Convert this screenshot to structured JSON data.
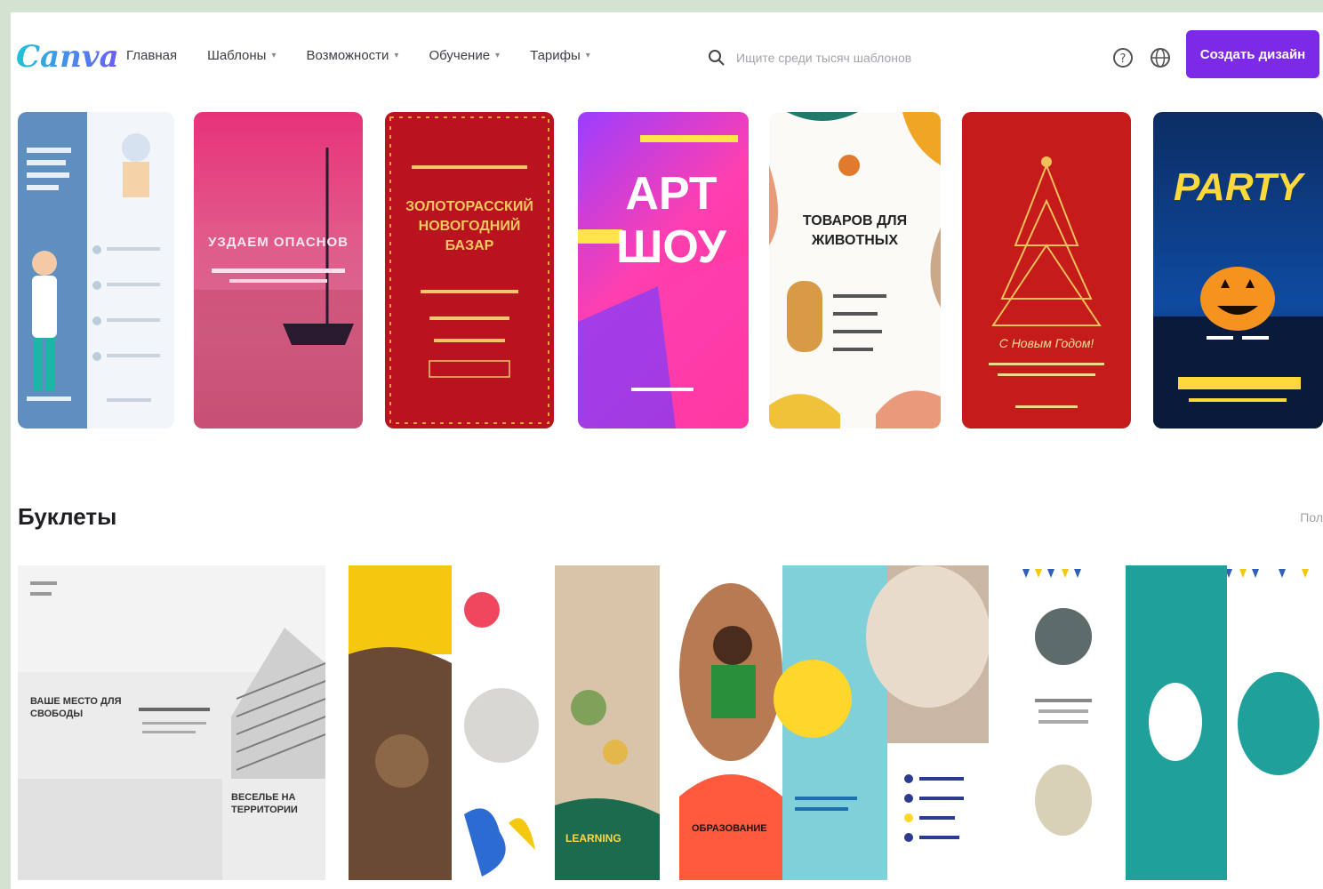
{
  "header": {
    "logo": "Canva",
    "nav": [
      {
        "label": "Главная",
        "has_menu": false
      },
      {
        "label": "Шаблоны",
        "has_menu": true
      },
      {
        "label": "Возможности",
        "has_menu": true
      },
      {
        "label": "Обучение",
        "has_menu": true
      },
      {
        "label": "Тарифы",
        "has_menu": true
      }
    ],
    "search_placeholder": "Ищите среди тысяч шаблонов",
    "create_button": "Создать дизайн"
  },
  "posters": [
    {
      "lines": []
    },
    {
      "title": "УЗДАЕМ ОПАСНОВ",
      "sub": ""
    },
    {
      "title": "ЗОЛОТОРАССКИЙ НОВОГОДНИЙ БАЗАР",
      "sub": ""
    },
    {
      "title": "АРТ ШОУ",
      "sub": ""
    },
    {
      "title": "ТОВАРОВ ДЛЯ ЖИВОТНЫХ",
      "sub": ""
    },
    {
      "title": "С Новым Годом!",
      "sub": ""
    },
    {
      "title": "PARTY",
      "sub": ""
    }
  ],
  "section": {
    "title": "Буклеты",
    "link": "Пол"
  },
  "booklets": [
    {
      "text_a": "ВАШЕ МЕСТО ДЛЯ СВОБОДЫ",
      "text_b": "ВЕСЕЛЬЕ НА ТЕРРИТОРИИ"
    },
    {
      "text_a": "LEARNING"
    },
    {
      "text_a": "ОБРАЗОВАНИЕ"
    },
    {
      "text_a": ""
    }
  ],
  "colors": {
    "accent": "#7d2ae8",
    "frame_bg": "#d4e2d2"
  }
}
